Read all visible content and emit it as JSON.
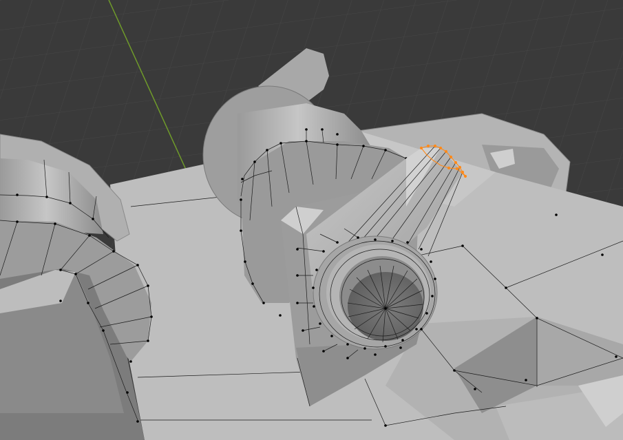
{
  "viewport": {
    "mode": "edit-mode",
    "background_color": "#3a3a3a",
    "grid_color": "#4a4a4a",
    "y_axis_color": "#6f9b2a",
    "mesh_light": "#bdbdbd",
    "mesh_mid": "#a4a4a4",
    "mesh_dark": "#6a6a6a",
    "selection_color": "#ff8a1a"
  },
  "selection": {
    "element": "tapered-cone-tip-edge-loop",
    "state": "selected"
  }
}
